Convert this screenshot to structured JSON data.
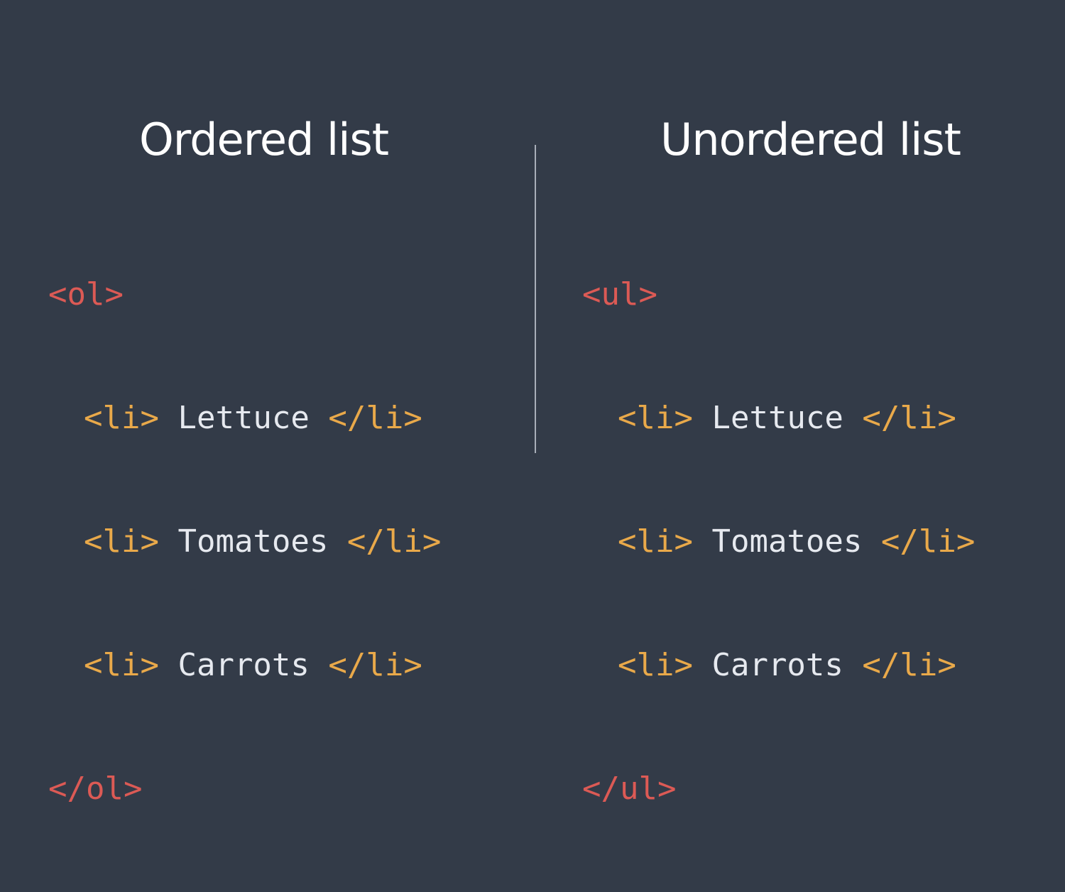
{
  "colors": {
    "background": "#333b48",
    "heading": "#ffffff",
    "outer_tag": "#dc5a55",
    "inner_tag": "#e9a94a",
    "item_text": "#e6e9ef",
    "divider": "#a9afb9"
  },
  "ordered": {
    "title": "Ordered list",
    "open_tag": "<ol>",
    "close_tag": "</ol>",
    "items": [
      {
        "open": "<li>",
        "text": "Lettuce",
        "close": "</li>"
      },
      {
        "open": "<li>",
        "text": "Tomatoes",
        "close": "</li>"
      },
      {
        "open": "<li>",
        "text": "Carrots",
        "close": "</li>"
      }
    ]
  },
  "unordered": {
    "title": "Unordered list",
    "open_tag": "<ul>",
    "close_tag": "</ul>",
    "items": [
      {
        "open": "<li>",
        "text": "Lettuce",
        "close": "</li>"
      },
      {
        "open": "<li>",
        "text": "Tomatoes",
        "close": "</li>"
      },
      {
        "open": "<li>",
        "text": "Carrots",
        "close": "</li>"
      }
    ]
  }
}
